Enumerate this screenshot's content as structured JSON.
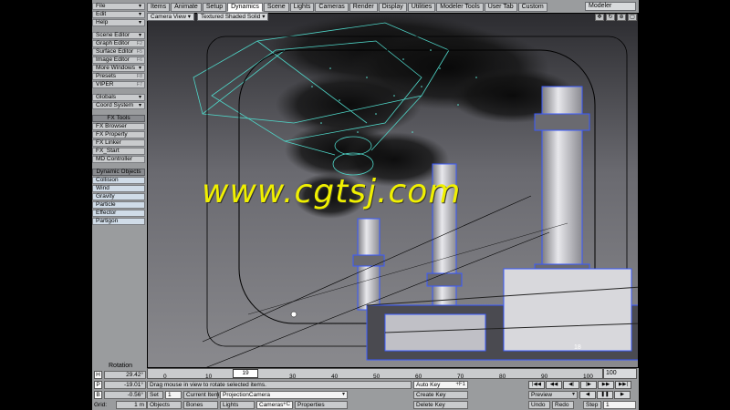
{
  "tabs": [
    "Items",
    "Animate",
    "Setup",
    "Dynamics",
    "Scene",
    "Lights",
    "Cameras",
    "Render",
    "Display",
    "Utilities",
    "Modeler Tools",
    "User Tab",
    "Custom"
  ],
  "active_tab": "Dynamics",
  "modeler_label": "Modeler",
  "menu": {
    "file": "File",
    "edit": "Edit",
    "help": "Help",
    "scene_editor": "Scene Editor",
    "graph_editor": "Graph Editor",
    "graph_editor_sc": "F2",
    "surface_editor": "Surface Editor",
    "surface_editor_sc": "F5",
    "image_editor": "Image Editor",
    "image_editor_sc": "F6",
    "more_windows": "More Windows",
    "presets": "Presets",
    "presets_sc": "F8",
    "viper": "VIPER",
    "viper_sc": "F7",
    "globals": "Globals",
    "coord_system": "Coord System",
    "fx_tools": "FX Tools",
    "fx_browser": "FX Browser",
    "fx_property": "FX Property",
    "fx_linker": "FX Linker",
    "fx_start": "FX_Start",
    "md_controller": "MD Controller",
    "dynamic_objects": "Dynamic Objects",
    "collision": "Collision",
    "wind": "Wind",
    "gravity": "Gravity",
    "particle": "Particle",
    "effector": "Effector",
    "partigon": "Partigon"
  },
  "viewport": {
    "camera_view": "Camera View",
    "shading": "Textured Shaded Solid",
    "frame_label": "18"
  },
  "watermark": "www.cgtsj.com",
  "rotation_label": "Rotation",
  "axes": [
    {
      "label": "H",
      "value": "29.42°"
    },
    {
      "label": "P",
      "value": "-19.01°"
    },
    {
      "label": "B",
      "value": "-0.56°"
    }
  ],
  "grid": {
    "label": "Grid:",
    "value": "1 m"
  },
  "timeline": {
    "start": "0",
    "ticks": [
      "0",
      "10",
      "20",
      "30",
      "40",
      "50",
      "60",
      "70",
      "80",
      "90",
      "100"
    ],
    "current": "19",
    "end": "100"
  },
  "status_text": "Drag mouse in view to rotate selected items.",
  "set_label": "Set",
  "set_value": "1",
  "current_item_label": "Current Item",
  "current_item_value": "ProjectionCamera",
  "bottom_tabs": {
    "objects": "Objects",
    "bones": "Bones",
    "lights": "Lights",
    "cameras": "Cameras",
    "cameras_sc": "+C",
    "properties": "Properties"
  },
  "keys": {
    "auto_key": "Auto Key",
    "auto_key_sc": "+F1",
    "create_key": "Create Key",
    "delete_key": "Delete Key"
  },
  "preview_label": "Preview",
  "undo_label": "Undo",
  "redo_label": "Redo",
  "step_label": "Step",
  "step_value": "1",
  "colors": {
    "panel": "#9a9c9e",
    "button": "#c9cbcd",
    "watermark": "#f0f000",
    "wire": "#4fd6c8"
  }
}
